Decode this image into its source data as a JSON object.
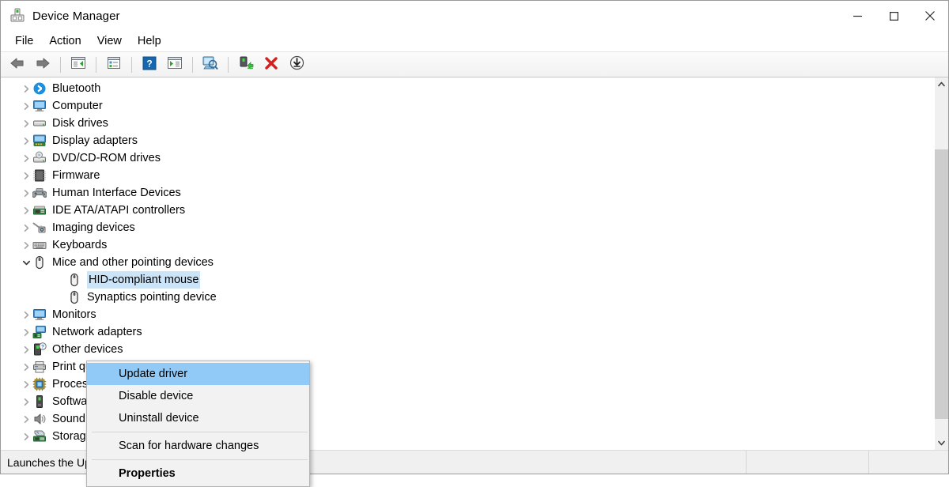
{
  "window": {
    "title": "Device Manager",
    "title_icon": "device-manager-icon",
    "minimize_label": "Minimize",
    "maximize_label": "Maximize",
    "close_label": "Close"
  },
  "menubar": {
    "items": [
      {
        "label": "File",
        "name": "menu-file"
      },
      {
        "label": "Action",
        "name": "menu-action"
      },
      {
        "label": "View",
        "name": "menu-view"
      },
      {
        "label": "Help",
        "name": "menu-help"
      }
    ]
  },
  "toolbar": {
    "buttons": [
      {
        "icon": "back-arrow-icon",
        "name": "toolbar-back"
      },
      {
        "icon": "forward-arrow-icon",
        "name": "toolbar-forward"
      },
      {
        "icon": "show-hide-console-tree-icon",
        "name": "toolbar-console-tree"
      },
      {
        "icon": "properties-icon",
        "name": "toolbar-properties"
      },
      {
        "icon": "help-question-icon",
        "name": "toolbar-help"
      },
      {
        "icon": "show-hide-action-pane-icon",
        "name": "toolbar-action-pane"
      },
      {
        "icon": "scan-for-hardware-changes-icon",
        "name": "toolbar-scan-hardware"
      },
      {
        "icon": "uninstall-device-red-x-icon",
        "name": "toolbar-uninstall"
      },
      {
        "icon": "update-driver-download-icon",
        "name": "toolbar-update-driver"
      }
    ]
  },
  "tree": {
    "nodes": [
      {
        "label": "Bluetooth",
        "icon": "bluetooth-icon",
        "level": 0,
        "expanded": false,
        "selected": false
      },
      {
        "label": "Computer",
        "icon": "computer-icon",
        "level": 0,
        "expanded": false,
        "selected": false
      },
      {
        "label": "Disk drives",
        "icon": "disk-drive-icon",
        "level": 0,
        "expanded": false,
        "selected": false
      },
      {
        "label": "Display adapters",
        "icon": "display-adapter-icon",
        "level": 0,
        "expanded": false,
        "selected": false
      },
      {
        "label": "DVD/CD-ROM drives",
        "icon": "dvd-drive-icon",
        "level": 0,
        "expanded": false,
        "selected": false
      },
      {
        "label": "Firmware",
        "icon": "firmware-chip-icon",
        "level": 0,
        "expanded": false,
        "selected": false
      },
      {
        "label": "Human Interface Devices",
        "icon": "hid-gamepad-icon",
        "level": 0,
        "expanded": false,
        "selected": false
      },
      {
        "label": "IDE ATA/ATAPI controllers",
        "icon": "ide-controller-icon",
        "level": 0,
        "expanded": false,
        "selected": false
      },
      {
        "label": "Imaging devices",
        "icon": "imaging-camera-icon",
        "level": 0,
        "expanded": false,
        "selected": false
      },
      {
        "label": "Keyboards",
        "icon": "keyboard-icon",
        "level": 0,
        "expanded": false,
        "selected": false
      },
      {
        "label": "Mice and other pointing devices",
        "icon": "mouse-icon",
        "level": 0,
        "expanded": true,
        "selected": false
      },
      {
        "label": "HID-compliant mouse",
        "icon": "mouse-icon",
        "level": 1,
        "expanded": null,
        "selected": true
      },
      {
        "label": "Synaptics pointing device",
        "icon": "mouse-icon",
        "level": 1,
        "expanded": null,
        "selected": false
      },
      {
        "label": "Monitors",
        "icon": "monitor-icon",
        "level": 0,
        "expanded": false,
        "selected": false
      },
      {
        "label": "Network adapters",
        "icon": "network-adapter-icon",
        "level": 0,
        "expanded": false,
        "selected": false
      },
      {
        "label": "Other devices",
        "icon": "other-devices-icon",
        "level": 0,
        "expanded": false,
        "selected": false
      },
      {
        "label": "Print queues",
        "icon": "printer-icon",
        "level": 0,
        "expanded": false,
        "selected": false
      },
      {
        "label": "Processors",
        "icon": "processor-icon",
        "level": 0,
        "expanded": false,
        "selected": false
      },
      {
        "label": "Software devices",
        "icon": "software-device-icon",
        "level": 0,
        "expanded": false,
        "selected": false
      },
      {
        "label": "Sound, video and game controllers",
        "icon": "speaker-icon",
        "level": 0,
        "expanded": false,
        "selected": false
      },
      {
        "label": "Storage controllers",
        "icon": "storage-controller-icon",
        "level": 0,
        "expanded": false,
        "selected": false
      }
    ]
  },
  "context_menu": {
    "items": [
      {
        "label": "Update driver",
        "highlighted": true,
        "bold": false,
        "separator_after": false,
        "name": "ctx-update-driver"
      },
      {
        "label": "Disable device",
        "highlighted": false,
        "bold": false,
        "separator_after": false,
        "name": "ctx-disable-device"
      },
      {
        "label": "Uninstall device",
        "highlighted": false,
        "bold": false,
        "separator_after": true,
        "name": "ctx-uninstall-device"
      },
      {
        "label": "Scan for hardware changes",
        "highlighted": false,
        "bold": false,
        "separator_after": true,
        "name": "ctx-scan-hardware-changes"
      },
      {
        "label": "Properties",
        "highlighted": false,
        "bold": true,
        "separator_after": false,
        "name": "ctx-properties"
      }
    ]
  },
  "statusbar": {
    "message": "Launches the Update Driver Wizard for the selected device.",
    "pane2": "",
    "pane3": ""
  },
  "scrollbar": {
    "up_arrow": "▲",
    "down_arrow": "▼",
    "thumb_top_pct": 17,
    "thumb_height_pct": 78
  },
  "colors": {
    "selection_blue": "#cce4f7",
    "menu_highlight_blue": "#91c9f7",
    "accent_red": "#d41f1f",
    "window_bg": "#ffffff",
    "chrome_gray": "#f0f0f0"
  }
}
